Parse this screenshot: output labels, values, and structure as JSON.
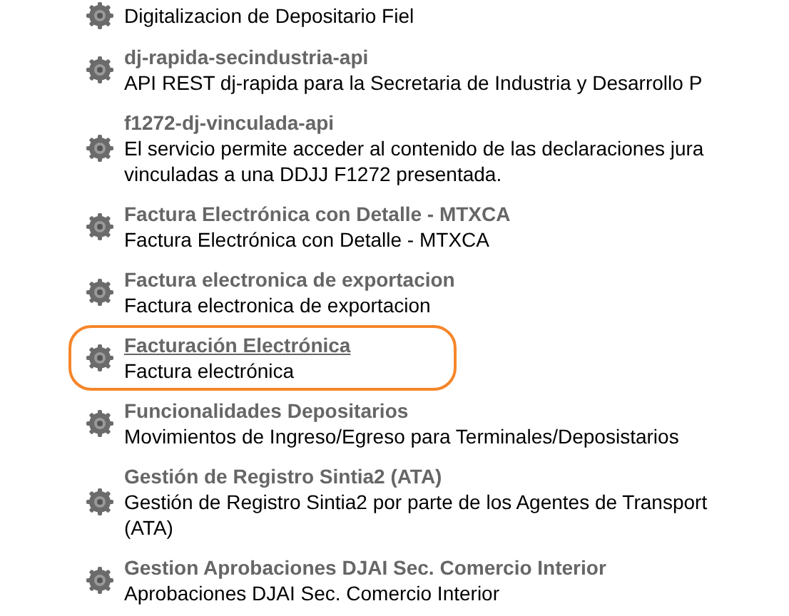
{
  "items": [
    {
      "description": [
        "Digitalizacion de Depositario Fiel"
      ],
      "highlighted": false
    },
    {
      "title": "dj-rapida-secindustria-api",
      "description": [
        "API REST dj-rapida para la Secretaria de Industria y Desarrollo P"
      ],
      "highlighted": false
    },
    {
      "title": "f1272-dj-vinculada-api",
      "description": [
        "El servicio permite acceder al contenido de las declaraciones jura",
        "vinculadas a una DDJJ F1272 presentada."
      ],
      "highlighted": false
    },
    {
      "title": "Factura Electrónica con Detalle - MTXCA",
      "description": [
        "Factura Electrónica con Detalle - MTXCA"
      ],
      "highlighted": false
    },
    {
      "title": "Factura electronica de exportacion",
      "description": [
        "Factura electronica de exportacion"
      ],
      "highlighted": false
    },
    {
      "title": "Facturación Electrónica",
      "description": [
        "Factura electrónica"
      ],
      "highlighted": true
    },
    {
      "title": "Funcionalidades Depositarios",
      "description": [
        "Movimientos de Ingreso/Egreso para Terminales/Deposistarios"
      ],
      "highlighted": false
    },
    {
      "title": "Gestión de Registro Sintia2 (ATA)",
      "description": [
        "Gestión de Registro Sintia2 por parte de los Agentes de Transport",
        "(ATA)"
      ],
      "highlighted": false
    },
    {
      "title": "Gestion Aprobaciones DJAI Sec. Comercio Interior",
      "description": [
        "Aprobaciones DJAI Sec. Comercio Interior"
      ],
      "highlighted": false
    }
  ]
}
